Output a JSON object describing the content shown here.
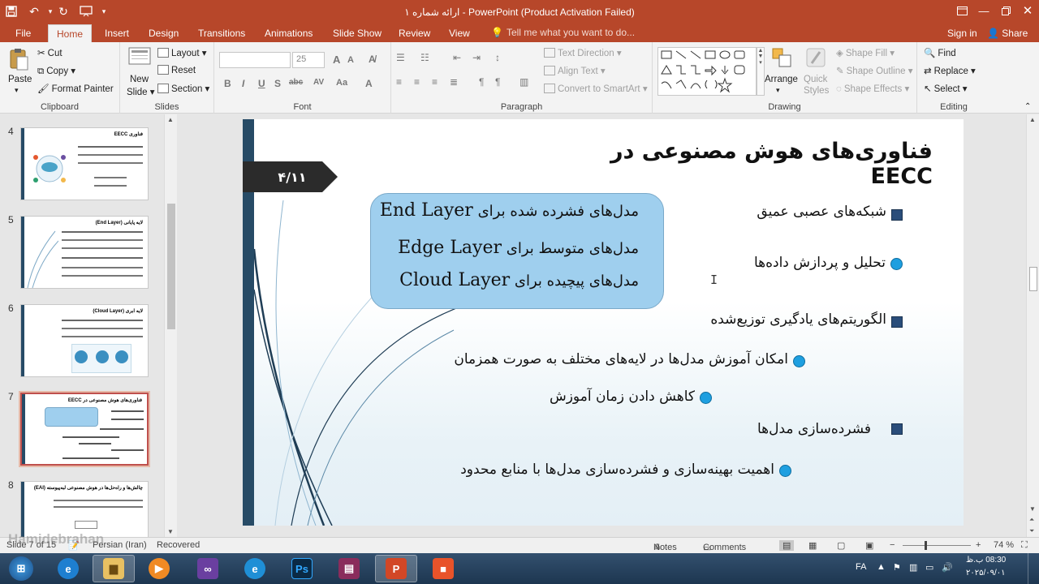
{
  "window": {
    "title": "ارائه شماره ۱ - PowerPoint (Product Activation Failed)",
    "controls": [
      "restore-ribbon-icon",
      "minimize-icon",
      "maximize-icon",
      "close-icon"
    ]
  },
  "quick_access": [
    "save-icon",
    "undo-icon",
    "redo-icon",
    "present-icon",
    "customize-icon"
  ],
  "tabs": [
    "File",
    "Home",
    "Insert",
    "Design",
    "Transitions",
    "Animations",
    "Slide Show",
    "Review",
    "View"
  ],
  "active_tab": "Home",
  "tell_me": "Tell me what you want to do...",
  "account": {
    "sign_in": "Sign in",
    "share": "Share"
  },
  "ribbon": {
    "clipboard": {
      "label": "Clipboard",
      "paste": "Paste",
      "cut": "Cut",
      "copy": "Copy",
      "format_painter": "Format Painter"
    },
    "slides": {
      "label": "Slides",
      "new_slide_1": "New",
      "new_slide_2": "Slide",
      "layout": "Layout",
      "reset": "Reset",
      "section": "Section"
    },
    "font": {
      "label": "Font",
      "font_name": "",
      "font_size": "25",
      "bold": "B",
      "italic": "I",
      "underline": "U",
      "shadow": "S",
      "strike": "abc",
      "grow": "A",
      "shrink": "A",
      "change_case": "Aa",
      "font_color": "A"
    },
    "paragraph": {
      "label": "Paragraph",
      "text_direction": "Text Direction",
      "align_text": "Align Text",
      "convert_smartart": "Convert to SmartArt"
    },
    "drawing": {
      "label": "Drawing",
      "arrange": "Arrange",
      "quick_styles_1": "Quick",
      "quick_styles_2": "Styles",
      "shape_fill": "Shape Fill",
      "shape_outline": "Shape Outline",
      "shape_effects": "Shape Effects"
    },
    "editing": {
      "label": "Editing",
      "find": "Find",
      "replace": "Replace",
      "select": "Select"
    }
  },
  "thumbnails": [
    {
      "number": "4",
      "title": "فناوری EECC",
      "selected": false
    },
    {
      "number": "5",
      "title": "لایه پایانی (End Layer)",
      "selected": false
    },
    {
      "number": "6",
      "title": "لایه ابری (Cloud Layer)",
      "selected": false
    },
    {
      "number": "7",
      "title": "فناوری‌های هوش مصنوعی در EECC",
      "selected": true
    },
    {
      "number": "8",
      "title": "چالش‌ها و راه‌حل‌ها در هوش مصنوعی لبه‌پیوسته (EAI)",
      "selected": false
    }
  ],
  "slide": {
    "badge": "۴/۱۱",
    "title": "فناوری‌های هوش مصنوعی در EECC",
    "callout": [
      {
        "text": "مدل‌های فشرده شده برای",
        "layer": "End Layer"
      },
      {
        "text": "مدل‌های متوسط برای",
        "layer": "Edge Layer"
      },
      {
        "text": "مدل‌های پیچیده برای",
        "layer": "Cloud Layer"
      }
    ],
    "bullets": [
      {
        "level": 1,
        "text": "شبکه‌های عصبی عمیق"
      },
      {
        "level": 2,
        "text": "تحلیل و پردازش داده‌ها"
      },
      {
        "level": 1,
        "text": "الگوریتم‌های یادگیری توزیع‌شده"
      },
      {
        "level": 2,
        "text": "امکان آموزش مدل‌ها در لایه‌های مختلف به صورت همزمان"
      },
      {
        "level": 2,
        "text": "کاهش دادن زمان آموزش"
      },
      {
        "level": 1,
        "text": "فشرده‌سازی مدل‌ها"
      },
      {
        "level": 2,
        "text": "اهمیت بهینه‌سازی و فشرده‌سازی مدل‌ها با منابع محدود"
      }
    ]
  },
  "status": {
    "slide_info": "Slide 7 of 15",
    "language": "Persian (Iran)",
    "recovered": "Recovered",
    "notes": "Notes",
    "comments": "Comments",
    "zoom": "74 %",
    "watermark": "Hamidebrahan"
  },
  "taskbar": {
    "apps": [
      "start-orb",
      "internet-explorer",
      "file-explorer",
      "media-player",
      "visual-studio",
      "edge",
      "photoshop",
      "winrar",
      "powerpoint",
      "recorder"
    ],
    "active_app": "powerpoint",
    "lang": "FA",
    "time": "08:30 ب.ظ",
    "date": "۲۰۲۵/۰۹/۰۱"
  }
}
